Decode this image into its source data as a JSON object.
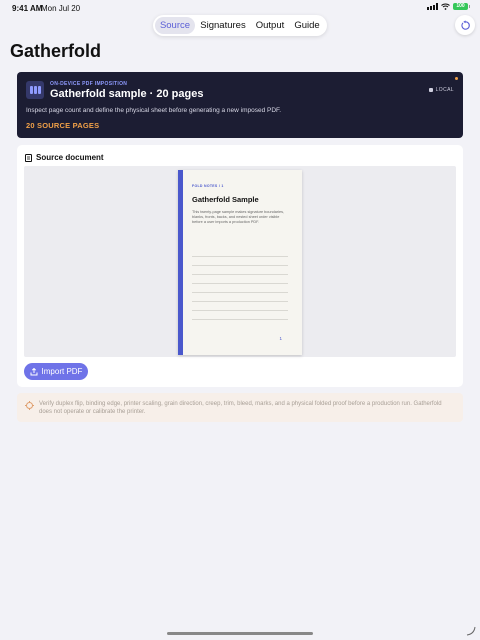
{
  "status_bar": {
    "time": "9:41 AM",
    "date": "Mon Jul 20",
    "battery": "100"
  },
  "tabs": [
    {
      "label": "Source",
      "active": true
    },
    {
      "label": "Signatures",
      "active": false
    },
    {
      "label": "Output",
      "active": false
    },
    {
      "label": "Guide",
      "active": false
    }
  ],
  "page_title": "Gatherfold",
  "hero": {
    "eyebrow": "ON-DEVICE PDF IMPOSITION",
    "title": "Gatherfold sample · 20 pages",
    "description": "Inspect page count and define the physical sheet before generating a new imposed PDF.",
    "count": "20 SOURCE PAGES",
    "badge": "LOCAL"
  },
  "source": {
    "title": "Source document",
    "doc_eyebrow": "FOLD NOTES / 1",
    "doc_title": "Gatherfold Sample",
    "doc_body": "This twenty-page sample makes signature boundaries, blanks, fronts, backs, and nested sheet order visible before a user imports a production PDF.",
    "doc_page": "1",
    "import_label": "Import PDF"
  },
  "warning": "Verify duplex flip, binding edge, printer scaling, grain direction, creep, trim, bleed, marks, and a physical folded proof before a production run. Gatherfold does not operate or calibrate the printer.",
  "colors": {
    "accent": "#5b5fd6",
    "hero_bg": "#1c1d33",
    "count": "#f0a048",
    "spine": "#4a58cc"
  },
  "icons": [
    "signal-icon",
    "wifi-icon",
    "battery-icon",
    "reset-icon",
    "imposition-icon",
    "lock-icon",
    "document-icon",
    "import-icon",
    "warning-icon"
  ]
}
